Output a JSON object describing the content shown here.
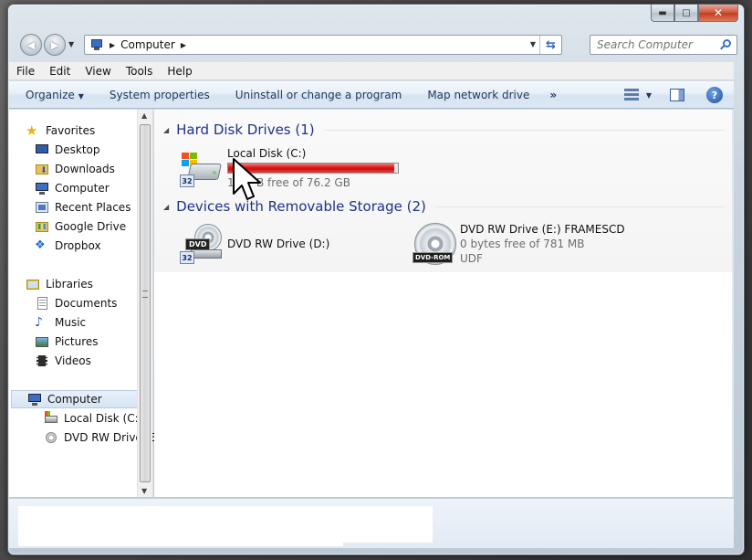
{
  "window": {
    "caption": {
      "minimize": "▬",
      "maximize": "□",
      "close": "✕"
    }
  },
  "nav": {
    "back_icon": "arrow-left",
    "forward_icon": "arrow-right"
  },
  "address": {
    "segment": "Computer"
  },
  "search": {
    "placeholder": "Search Computer"
  },
  "menu": [
    "File",
    "Edit",
    "View",
    "Tools",
    "Help"
  ],
  "commands": {
    "organize": "Organize",
    "system_properties": "System properties",
    "uninstall": "Uninstall or change a program",
    "map_drive": "Map network drive",
    "more": "»"
  },
  "navpane": {
    "favorites": "Favorites",
    "desktop": "Desktop",
    "downloads": "Downloads",
    "computer": "Computer",
    "recent": "Recent Places",
    "google_drive": "Google Drive",
    "dropbox": "Dropbox",
    "libraries": "Libraries",
    "documents": "Documents",
    "music": "Music",
    "pictures": "Pictures",
    "videos": "Videos",
    "computer_root": "Computer",
    "local_disk": "Local Disk (C:)",
    "dvd": "DVD RW Drive (E:"
  },
  "groups": {
    "hdd": "Hard Disk Drives (1)",
    "removable": "Devices with Removable Storage (2)"
  },
  "drives": {
    "c": {
      "name": "Local Disk (C:)",
      "free_prefix": "1.",
      "free_suffix": "B free of 76.2 GB",
      "used_fraction": 0.98,
      "icon_badge": "32"
    },
    "d": {
      "name": "DVD RW Drive (D:)",
      "icon_label": "DVD",
      "icon_badge": "32"
    },
    "e": {
      "name": "DVD RW Drive (E:) FRAMESCD",
      "free": "0 bytes free of 781 MB",
      "fs": "UDF",
      "icon_label": "DVD-ROM"
    }
  },
  "colors": {
    "accent": "#1e3287",
    "bar_full": "#e01e1e",
    "help": "#1f4f9c"
  }
}
